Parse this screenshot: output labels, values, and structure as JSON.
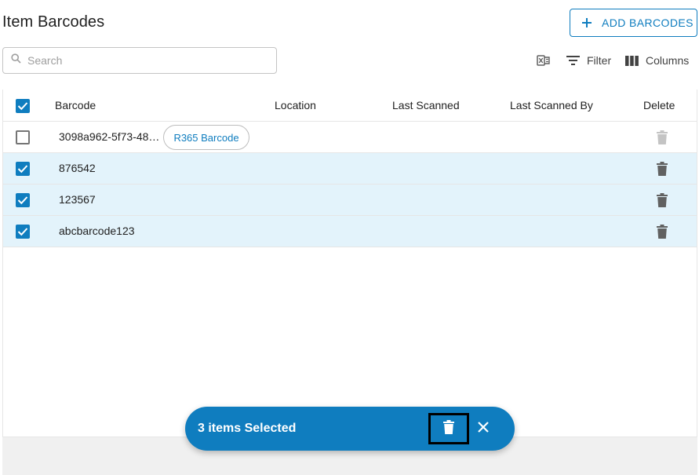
{
  "page": {
    "title": "Item Barcodes"
  },
  "actions": {
    "add_barcodes_label": "ADD BARCODES"
  },
  "search": {
    "placeholder": "Search",
    "value": ""
  },
  "toolbar": {
    "export_icon": "excel-export-icon",
    "filter_label": "Filter",
    "columns_label": "Columns"
  },
  "grid": {
    "columns": [
      "Barcode",
      "Location",
      "Last Scanned",
      "Last Scanned By",
      "Delete"
    ],
    "rows": [
      {
        "barcode": "3098a962-5f73-48…",
        "tag": "R365 Barcode",
        "location": "",
        "last_scanned": "",
        "last_scanned_by": "",
        "selected": false,
        "deletable": false
      },
      {
        "barcode": "876542",
        "location": "",
        "last_scanned": "",
        "last_scanned_by": "",
        "selected": true,
        "deletable": true
      },
      {
        "barcode": "123567",
        "location": "",
        "last_scanned": "",
        "last_scanned_by": "",
        "selected": true,
        "deletable": true
      },
      {
        "barcode": "abcbarcode123",
        "location": "",
        "last_scanned": "",
        "last_scanned_by": "",
        "selected": true,
        "deletable": true
      }
    ],
    "header_checkbox_checked": true
  },
  "selection_bar": {
    "text": "3 items Selected"
  },
  "colors": {
    "accent": "#0f7dbf",
    "selected_row": "#e3f3fb",
    "disabled_icon": "#c4c4c4",
    "icon": "#616161"
  }
}
